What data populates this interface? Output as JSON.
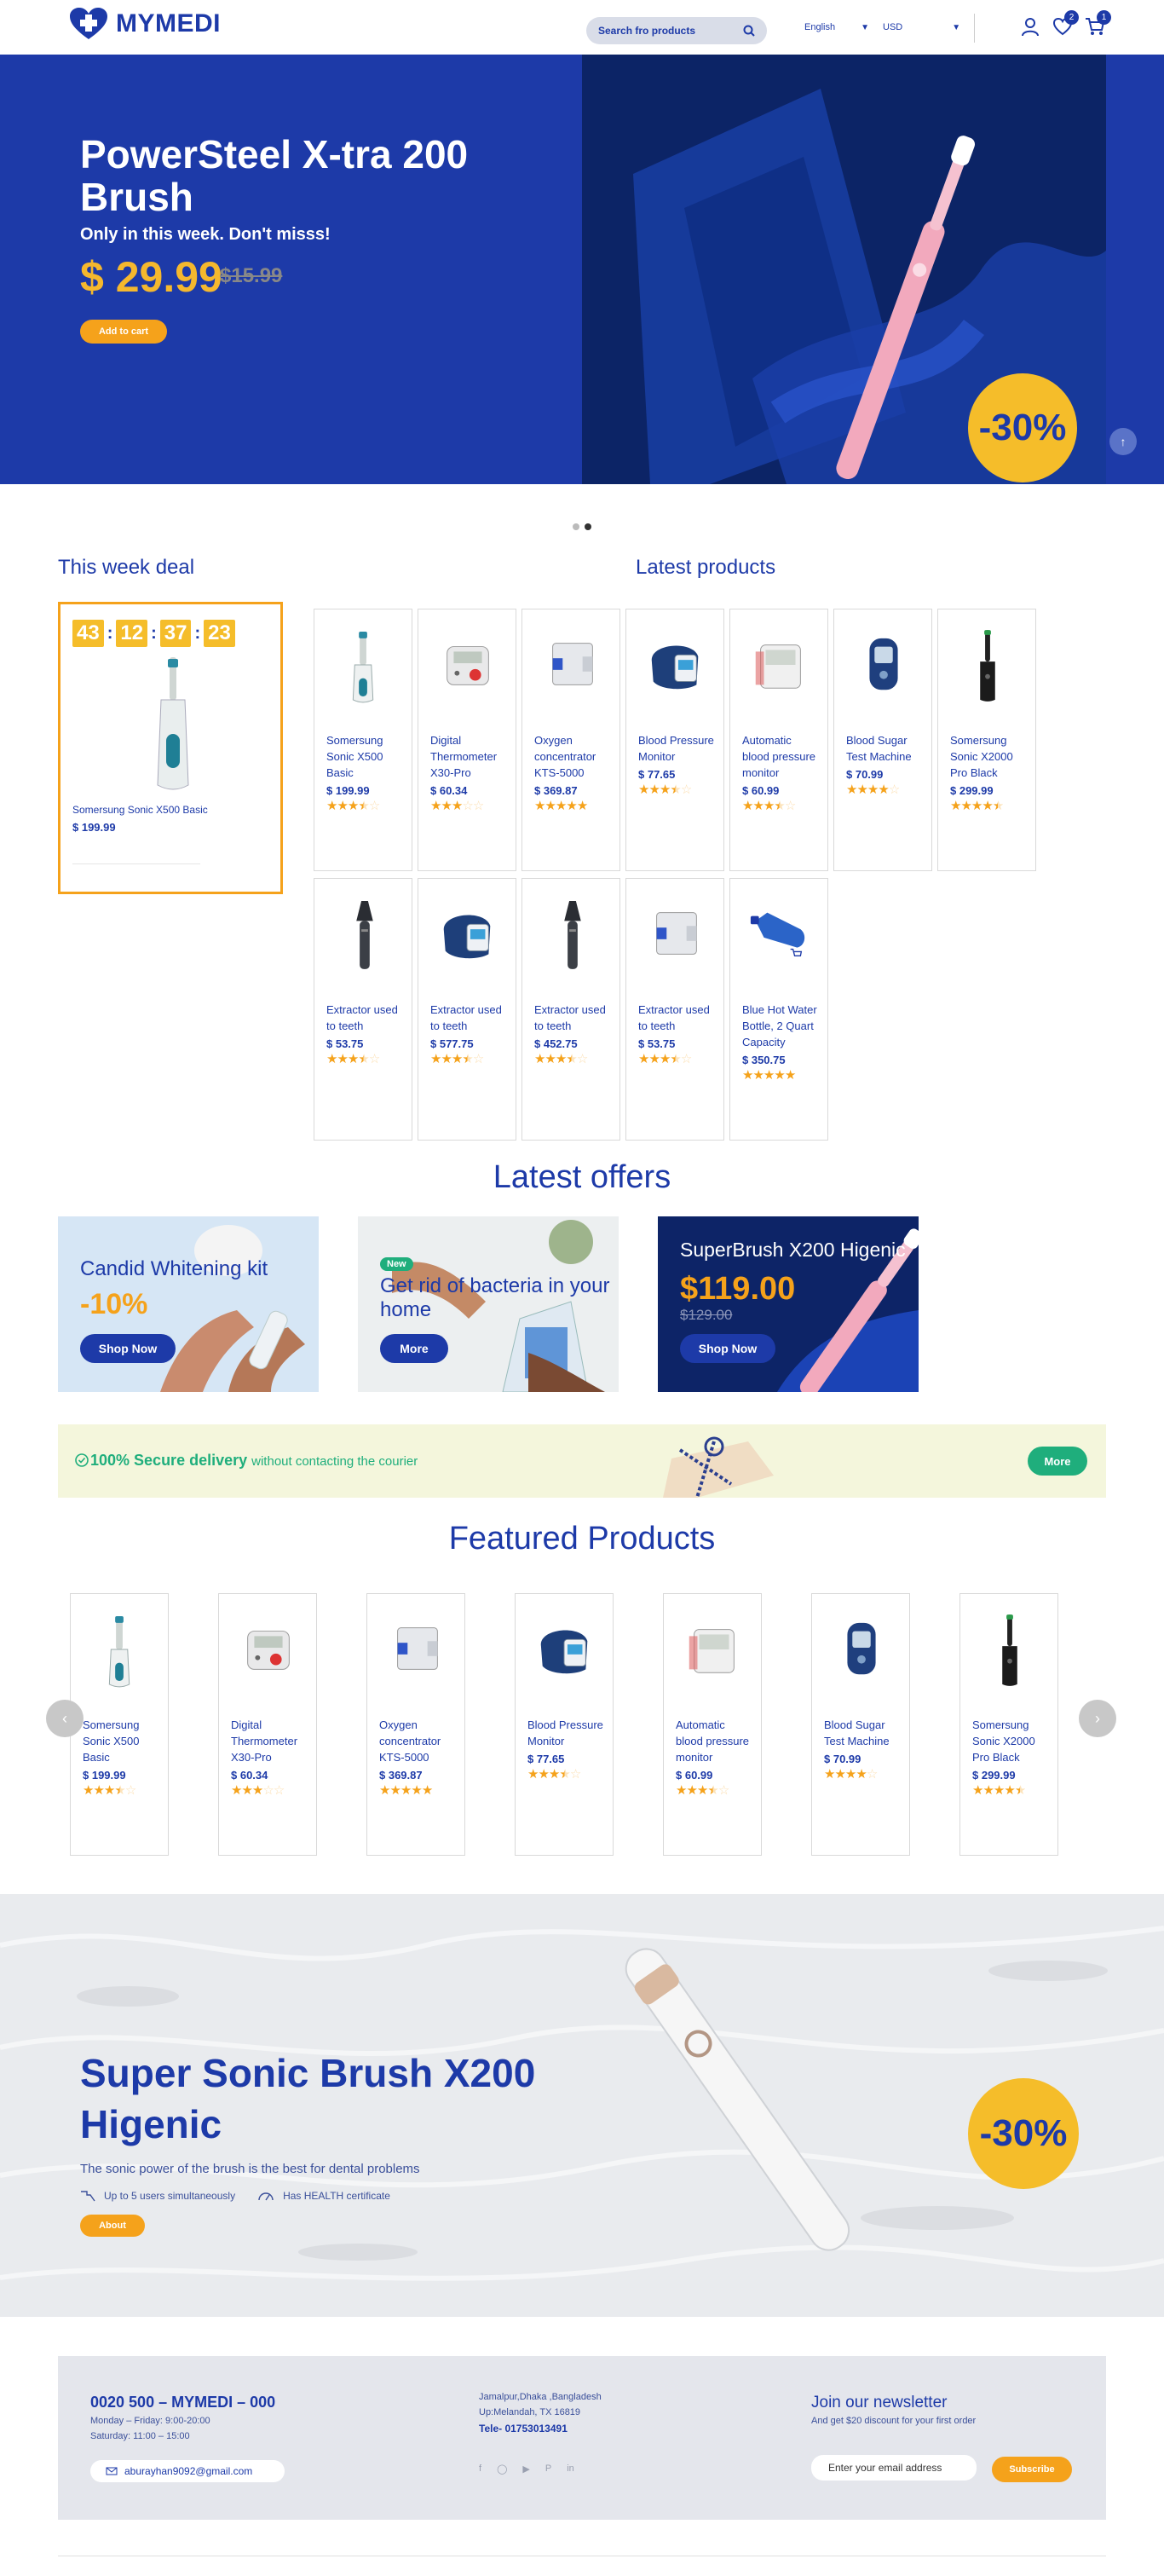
{
  "header": {
    "logo_text": "MYMEDI",
    "search_placeholder": "Search fro products",
    "language": "English",
    "currency": "USD",
    "wishlist_count": "2",
    "cart_count": "1"
  },
  "hero": {
    "title": "PowerSteel X-tra 200 Brush",
    "subtitle": "Only in this week. Don't misss!",
    "price": "$ 29.99",
    "old_price": "$15.99",
    "cta": "Add to cart",
    "discount": "-30%"
  },
  "week_deal": {
    "title": "This week deal",
    "timer": [
      "43",
      "12",
      "37",
      "23"
    ],
    "product_name": "Somersung Sonic X500 Basic",
    "price": "$ 199.99"
  },
  "latest_products": {
    "title": "Latest products",
    "items": [
      {
        "name": "Somersung Sonic X500 Basic",
        "price": "$ 199.99",
        "rating": 3.5,
        "icon": "toothbrush-icon"
      },
      {
        "name": "Digital Thermometer X30-Pro",
        "price": "$ 60.34",
        "rating": 3,
        "icon": "thermometer-icon"
      },
      {
        "name": "Oxygen concentrator KTS-5000",
        "price": "$ 369.87",
        "rating": 5,
        "icon": "concentrator-icon"
      },
      {
        "name": "Blood Pressure Monitor",
        "price": "$ 77.65",
        "rating": 3.5,
        "icon": "bp-cuff-icon"
      },
      {
        "name": "Automatic blood pressure monitor",
        "price": "$ 60.99",
        "rating": 3.5,
        "icon": "bp-monitor-icon"
      },
      {
        "name": "Blood Sugar Test Machine",
        "price": "$ 70.99",
        "rating": 4,
        "icon": "glucose-meter-icon"
      },
      {
        "name": "Somersung Sonic X2000 Pro Black",
        "price": "$ 299.99",
        "rating": 4.5,
        "icon": "black-toothbrush-icon"
      },
      {
        "name": "Extractor used to teeth",
        "price": "$ 53.75",
        "rating": 3.5,
        "icon": "otoscope-icon"
      },
      {
        "name": "Extractor used to teeth",
        "price": "$ 577.75",
        "rating": 3.5,
        "icon": "bp-cuff-icon"
      },
      {
        "name": "Extractor used to teeth",
        "price": "$ 452.75",
        "rating": 3.5,
        "icon": "otoscope-icon"
      },
      {
        "name": "Extractor used to teeth",
        "price": "$ 53.75",
        "rating": 3.5,
        "icon": "concentrator-icon"
      },
      {
        "name": "Blue Hot Water Bottle, 2 Quart Capacity",
        "price": "$ 350.75",
        "rating": 5,
        "icon": "water-bottle-icon"
      }
    ]
  },
  "offers": {
    "title": "Latest offers",
    "items": [
      {
        "title": "Candid Whitening kit",
        "highlight": "-10%",
        "button": "Shop Now"
      },
      {
        "badge": "New",
        "title": "Get rid of bacteria in your home",
        "button": "More"
      },
      {
        "title": "SuperBrush X200 Higenic",
        "price": "$119.00",
        "old_price": "$129.00",
        "button": "Shop Now"
      }
    ]
  },
  "delivery": {
    "bold": "100% Secure delivery",
    "rest": "without contacting the courier",
    "button": "More"
  },
  "featured": {
    "title": "Featured Products",
    "items": [
      {
        "name": "Somersung Sonic X500 Basic",
        "price": "$ 199.99",
        "rating": 3.5,
        "icon": "toothbrush-icon"
      },
      {
        "name": "Digital Thermometer X30-Pro",
        "price": "$ 60.34",
        "rating": 3,
        "icon": "thermometer-icon"
      },
      {
        "name": "Oxygen concentrator KTS-5000",
        "price": "$ 369.87",
        "rating": 5,
        "icon": "concentrator-icon"
      },
      {
        "name": "Blood Pressure Monitor",
        "price": "$ 77.65",
        "rating": 3.5,
        "icon": "bp-cuff-icon"
      },
      {
        "name": "Automatic blood pressure monitor",
        "price": "$ 60.99",
        "rating": 3.5,
        "icon": "bp-monitor-icon"
      },
      {
        "name": "Blood Sugar Test Machine",
        "price": "$ 70.99",
        "rating": 4,
        "icon": "glucose-meter-icon"
      },
      {
        "name": "Somersung Sonic X2000 Pro Black",
        "price": "$ 299.99",
        "rating": 4.5,
        "icon": "black-toothbrush-icon"
      }
    ]
  },
  "promo": {
    "title": "Super Sonic Brush X200 Higenic",
    "description": "The sonic power of the brush is the best for dental problems",
    "feature_1": "Up to 5 users simultaneously",
    "feature_2": "Has HEALTH certificate",
    "cta": "About",
    "discount": "-30%"
  },
  "footer": {
    "phone_title": "0020 500 – MYMEDI – 000",
    "hours_1": "Monday – Friday: 9:00-20:00",
    "hours_2": "Saturday: 11:00 – 15:00",
    "email": "aburayhan9092@gmail.com",
    "address_1": "Jamalpur,Dhaka ,Bangladesh",
    "address_2": "Up:Melandah, TX 16819",
    "tele": "Tele- 01753013491",
    "newsletter_title": "Join our newsletter",
    "newsletter_sub": "And get $20 discount for your first order",
    "email_placeholder": "Enter your email address",
    "subscribe": "Subscribe"
  }
}
